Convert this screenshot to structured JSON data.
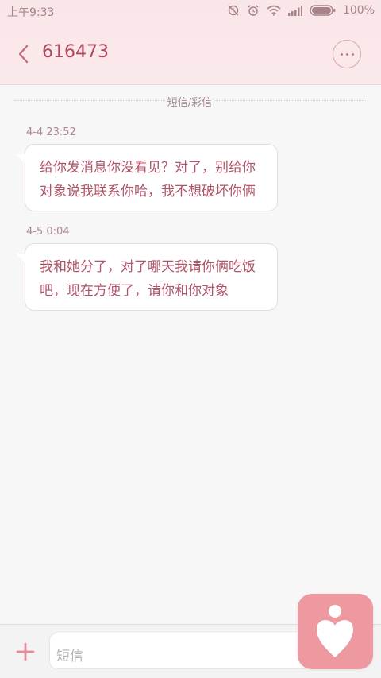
{
  "status_bar": {
    "time": "上午9:33",
    "battery": "100%"
  },
  "header": {
    "back_icon": "chevron-left-icon",
    "contact_number": "616473",
    "more_icon": "more-dots-icon"
  },
  "conversation": {
    "channel_label": "短信/彩信",
    "messages": [
      {
        "time": "4-4 23:52",
        "lines": [
          "给你发消息你没看见？对了，别给你",
          "对象说我联系你哈，我不想破坏你俩"
        ]
      },
      {
        "time": "4-5 0:04",
        "lines": [
          "我和她分了，对了哪天我请你俩吃饭",
          "吧，现在方便了，请你和你对象"
        ]
      }
    ]
  },
  "composer": {
    "add_icon": "plus-icon",
    "input_placeholder": "短信"
  },
  "floating_app": {
    "icon": "heart-person-icon",
    "color": "#ee98a0"
  }
}
